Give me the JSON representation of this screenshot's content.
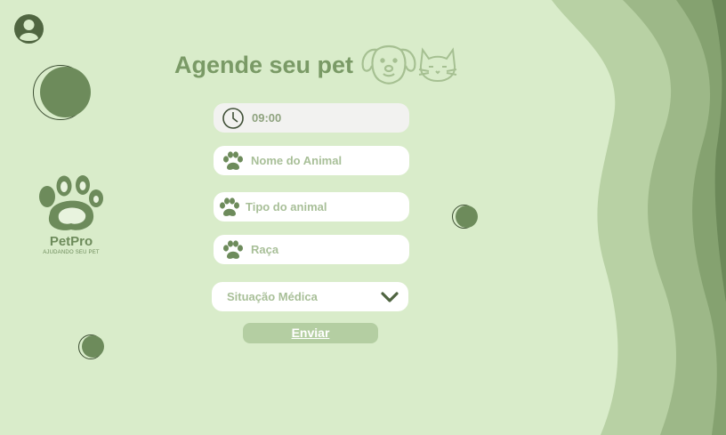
{
  "header": {
    "title": "Agende seu pet"
  },
  "brand": {
    "name": "PetPro",
    "tagline": "AJUDANDO SEU PET"
  },
  "form": {
    "time_value": "09:00",
    "animal_name_placeholder": "Nome do Animal",
    "animal_type_placeholder": "Tipo do animal",
    "breed_placeholder": "Raça",
    "medical_select_value": "Situação Médica",
    "submit_label": "Enviar"
  },
  "icons": {
    "profile": "user-avatar-icon",
    "clock": "clock-icon",
    "paw": "paw-icon",
    "chevron": "chevron-down-icon",
    "dog": "dog-face-icon",
    "cat": "cat-face-icon"
  },
  "colors": {
    "background": "#d9ecca",
    "accent": "#6d8b5b",
    "title": "#7a9a66",
    "button": "#b4cea2",
    "field": "#ffffff"
  }
}
